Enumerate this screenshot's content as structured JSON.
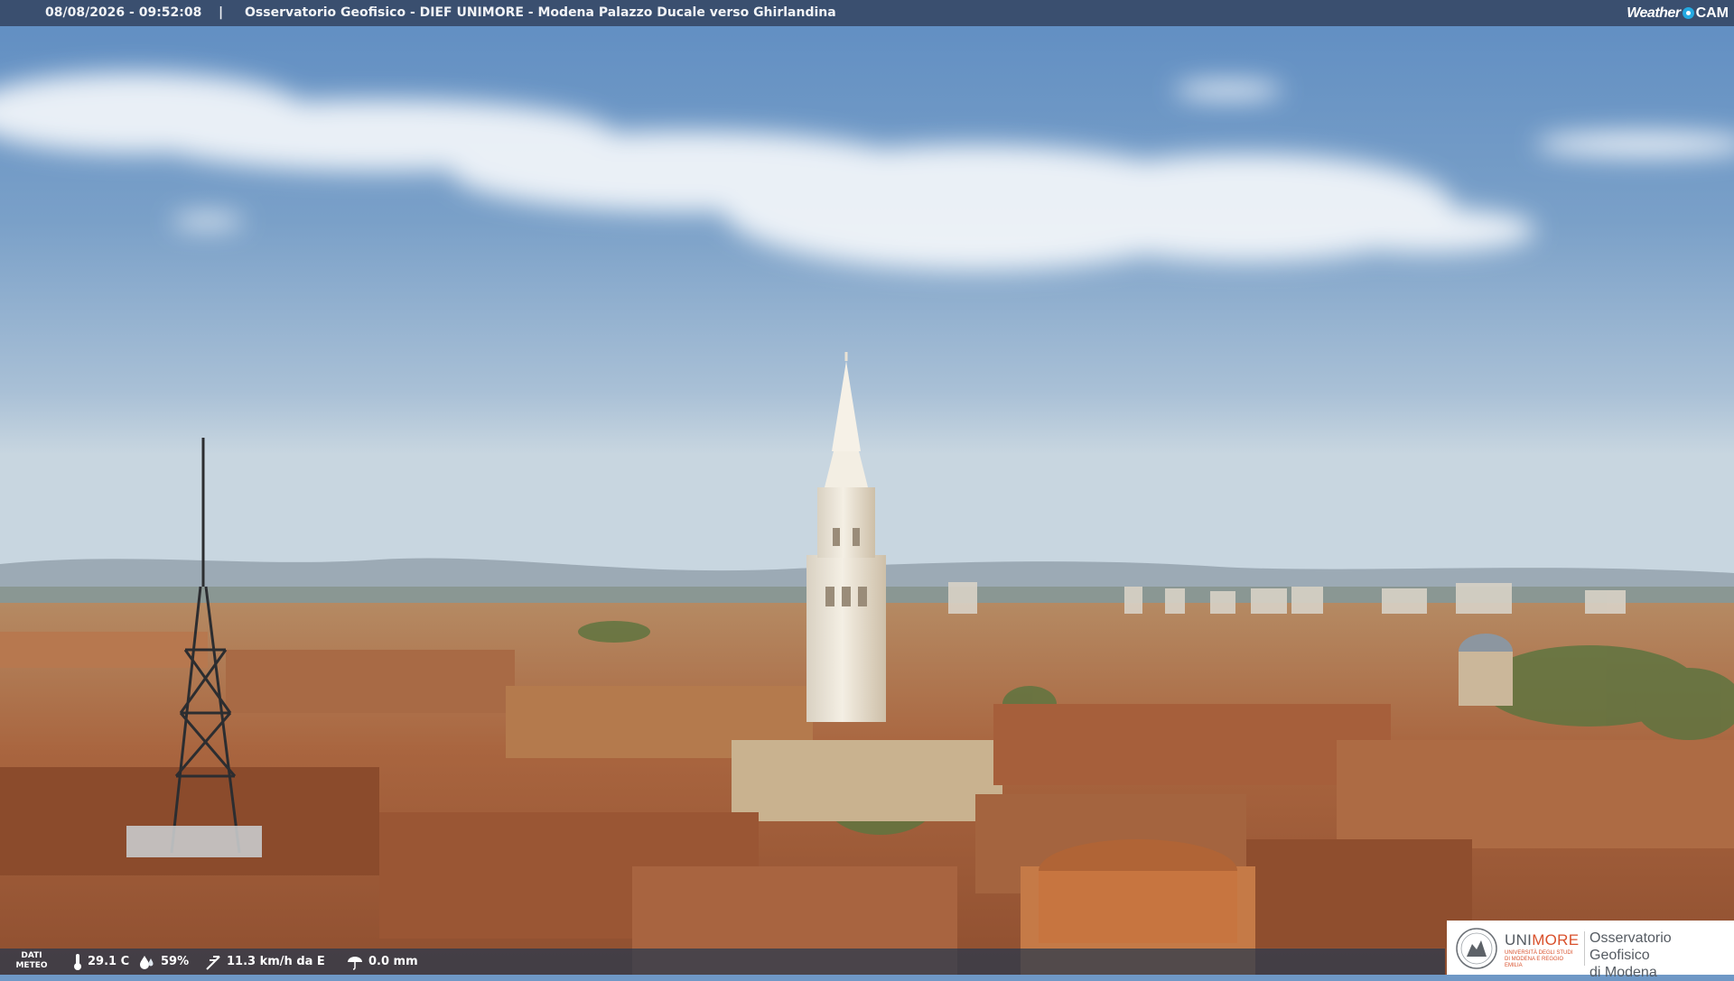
{
  "header": {
    "timestamp": "08/08/2026 - 09:52:08",
    "separator": "|",
    "title": "Osservatorio Geofisico - DIEF UNIMORE - Modena Palazzo Ducale verso Ghirlandina",
    "brand_weather": "Weather",
    "brand_cam": "CAM"
  },
  "weather_bar": {
    "label_line1": "DATI",
    "label_line2": "METEO",
    "temperature": "29.1 C",
    "humidity": "59%",
    "wind": "11.3 km/h da E",
    "rain": "0.0 mm",
    "icons": [
      "thermometer-icon",
      "humidity-drop-icon",
      "wind-icon",
      "rain-icon"
    ]
  },
  "logo": {
    "unimore_uni": "UNI",
    "unimore_more": "MORE",
    "unimore_subtitle": "UNIVERSITÀ DEGLI STUDI DI MODENA E REGGIO EMILIA",
    "observatory_line1": "Osservatorio Geofisico",
    "observatory_line2": "di Modena"
  },
  "colors": {
    "sky_top": "#6f98c6",
    "sky_horizon": "#c6d6e2",
    "roofs": "#b7754a",
    "tower": "#eee7d8",
    "unimore_accent": "#d9512c",
    "brand_accent": "#24a9e1"
  }
}
